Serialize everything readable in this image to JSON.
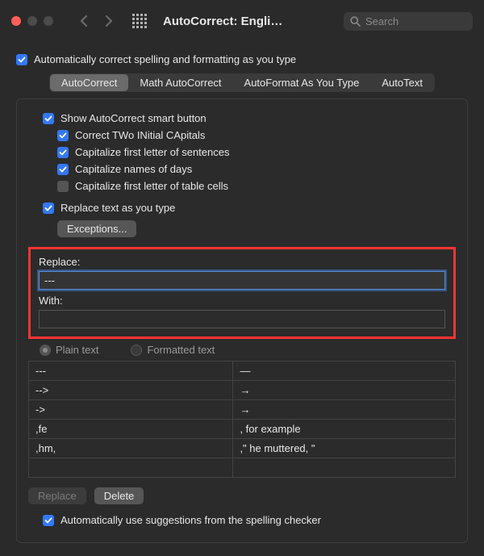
{
  "window": {
    "title": "AutoCorrect: Engli…",
    "search_placeholder": "Search"
  },
  "top_checkbox": {
    "label": "Automatically correct spelling and formatting as you type",
    "checked": true
  },
  "tabs": [
    {
      "label": "AutoCorrect",
      "active": true
    },
    {
      "label": "Math AutoCorrect",
      "active": false
    },
    {
      "label": "AutoFormat As You Type",
      "active": false
    },
    {
      "label": "AutoText",
      "active": false
    }
  ],
  "options": {
    "smart_button": {
      "label": "Show AutoCorrect smart button",
      "checked": true
    },
    "two_initial": {
      "label": "Correct TWo INitial CApitals",
      "checked": true
    },
    "first_sentence": {
      "label": "Capitalize first letter of sentences",
      "checked": true
    },
    "days": {
      "label": "Capitalize names of days",
      "checked": true
    },
    "table_cells": {
      "label": "Capitalize first letter of table cells",
      "checked": false
    },
    "replace_as_type": {
      "label": "Replace text as you type",
      "checked": true
    }
  },
  "buttons": {
    "exceptions": "Exceptions...",
    "replace": "Replace",
    "delete": "Delete"
  },
  "replace_section": {
    "replace_label": "Replace:",
    "replace_value": "---",
    "with_label": "With:",
    "with_value": "",
    "radio_plain": "Plain text",
    "radio_formatted": "Formatted text"
  },
  "table": [
    {
      "from": "---",
      "to": "—"
    },
    {
      "from": "-->",
      "to": "→"
    },
    {
      "from": "->",
      "to": "→"
    },
    {
      "from": ",fe",
      "to": ", for example"
    },
    {
      "from": ",hm,",
      "to": ",\" he muttered, \""
    }
  ],
  "footer_checkbox": {
    "label": "Automatically use suggestions from the spelling checker",
    "checked": true
  }
}
